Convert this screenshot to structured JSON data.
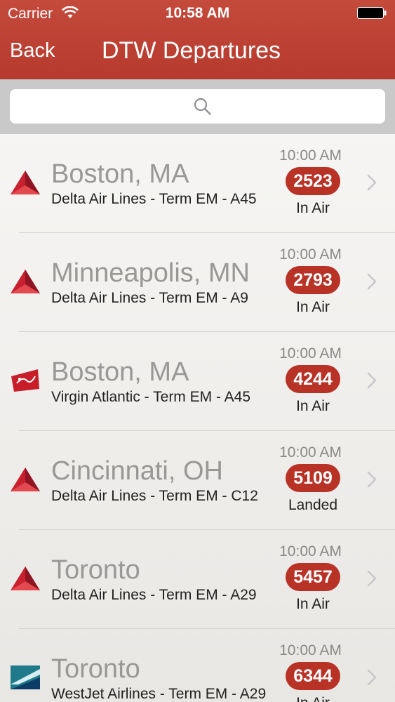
{
  "status_bar": {
    "carrier": "Carrier",
    "time": "10:58 AM"
  },
  "nav": {
    "back_label": "Back",
    "title": "DTW Departures"
  },
  "search": {
    "placeholder": "",
    "value": ""
  },
  "flights": [
    {
      "city": "Boston, MA",
      "details": "Delta Air Lines - Term EM - A45",
      "time": "10:00 AM",
      "flight": "2523",
      "status": "In Air",
      "logo": "delta-logo-icon"
    },
    {
      "city": "Minneapolis, MN",
      "details": "Delta Air Lines - Term EM - A9",
      "time": "10:00 AM",
      "flight": "2793",
      "status": "In Air",
      "logo": "delta-logo-icon"
    },
    {
      "city": "Boston, MA",
      "details": "Virgin Atlantic - Term EM - A45",
      "time": "10:00 AM",
      "flight": "4244",
      "status": "In Air",
      "logo": "virgin-logo-icon"
    },
    {
      "city": "Cincinnati, OH",
      "details": "Delta Air Lines - Term EM - C12",
      "time": "10:00 AM",
      "flight": "5109",
      "status": "Landed",
      "logo": "delta-logo-icon"
    },
    {
      "city": "Toronto",
      "details": "Delta Air Lines - Term EM - A29",
      "time": "10:00 AM",
      "flight": "5457",
      "status": "In Air",
      "logo": "delta-logo-icon"
    },
    {
      "city": "Toronto",
      "details": "WestJet Airlines - Term EM - A29",
      "time": "10:00 AM",
      "flight": "6344",
      "status": "In Air",
      "logo": "westjet-logo-icon"
    }
  ],
  "colors": {
    "header": "#b63a2d",
    "badge": "#b83226",
    "city_text": "#9a9896"
  }
}
